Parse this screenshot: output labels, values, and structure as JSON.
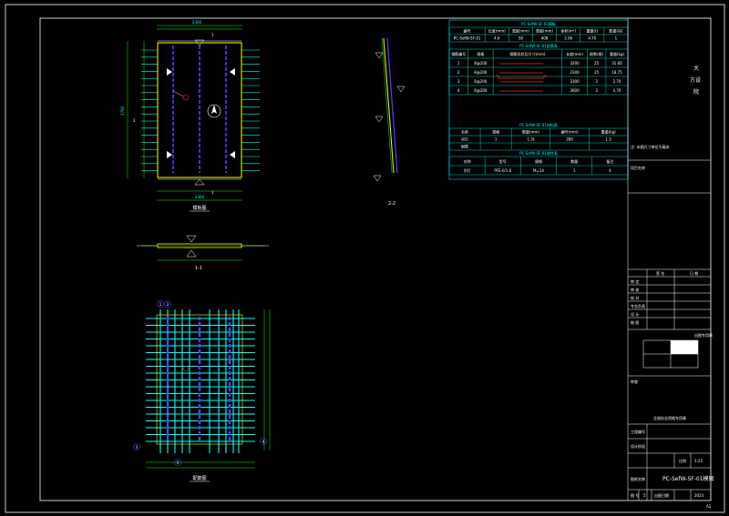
{
  "colors": {
    "background": "#000000",
    "frame": "#ffffff",
    "cyan": "#00ffff",
    "yellow": "#ffff00",
    "green": "#00ff00",
    "purple": "#5a3cff",
    "red": "#ff2020",
    "magenta": "#ff00ff"
  },
  "plan_view": {
    "title": "模板图",
    "top_dim": "2300",
    "left_dim": "3700",
    "bottom_dim": "3300",
    "section_mark": "1",
    "section_mark_2": "2"
  },
  "section_11": {
    "label": "1-1"
  },
  "section_22": {
    "label": "2-2"
  },
  "rebar_plan": {
    "title": "配筋图",
    "bubbles": [
      "1",
      "2",
      "3",
      "4",
      "5"
    ]
  },
  "table1": {
    "title": "PC-SefW-SF-01模板",
    "headers": [
      "编号",
      "长度(mm)",
      "宽度(mm)",
      "厚度(mm)",
      "体积(m³)",
      "重量(t)",
      "数量(块)"
    ],
    "row": [
      "PC-SefW-SF-01",
      "4.6",
      "58",
      "408",
      "2.06",
      "4.70",
      "1"
    ]
  },
  "table2": {
    "title": "PC-SefW-SF-01配筋表",
    "headers": [
      "钢筋编号",
      "规格",
      "钢筋形状及尺寸(mm)",
      "长度(mm)",
      "根数(根)",
      "重量(kg)"
    ],
    "rows": [
      [
        "1",
        "8@200",
        "",
        "3200",
        "25",
        "31.60"
      ],
      [
        "2",
        "8@200",
        "",
        "2300",
        "25",
        "18.75"
      ],
      [
        "3",
        "8@200",
        "",
        "2300",
        "3",
        "2.70"
      ],
      [
        "4",
        "8@200",
        "",
        "3600",
        "3",
        "4.70"
      ]
    ]
  },
  "table3": {
    "title": "PC-SefW-SF-01材料表",
    "headers": [
      "名称",
      "规格",
      "数量(mm)",
      "编号(mm)",
      "重量(kg)"
    ],
    "rows": [
      [
        "吊钉",
        "1",
        "1.5t",
        "280",
        "1.5"
      ],
      [
        "钢筋",
        "",
        "",
        "",
        ""
      ]
    ]
  },
  "table4": {
    "title": "PC-SefW-SF-01埋件表",
    "headers": [
      "名称",
      "型号",
      "规格",
      "数量",
      "备注"
    ],
    "row": [
      "吊钉",
      "PFE-0/1.6",
      "M=14",
      "1",
      "4"
    ]
  },
  "title_block": {
    "company_line1": "大",
    "company_line2": "方设",
    "company_line3": "院",
    "note": "注: 本图尺寸单位为毫米",
    "project_label": "项目名称",
    "sign_header_1": "签 名",
    "sign_header_2": "日 期",
    "roles": [
      "审 定",
      "审 核",
      "校 对",
      "专业负责",
      "设 计",
      "制 图"
    ],
    "stamp_label": "出图专用章",
    "seal_label": "审查",
    "registration": "注册执业资格专用章",
    "job_label": "工程编号",
    "design_stage": "设计阶段",
    "scale_label": "比例",
    "scale_value": "1:25",
    "drawing_label": "图纸名称",
    "drawing_name": "PC-SefW-SF-01模图",
    "sheet_label": "图 号",
    "sheet_no": "5",
    "date_label": "出图日期",
    "version": "2023"
  },
  "corner_mark": "A2"
}
